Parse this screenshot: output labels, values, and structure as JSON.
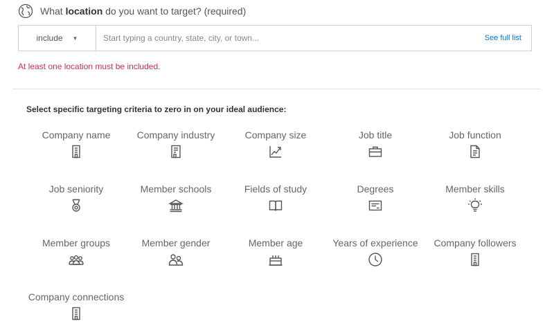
{
  "question": {
    "prefix": "What ",
    "bold": "location",
    "suffix": " do you want to target? (required)"
  },
  "location_box": {
    "include_label": "include",
    "caret": "▼",
    "placeholder": "Start typing a country, state, city, or town...",
    "see_full_list": "See full list"
  },
  "error_message": "At least one location must be included.",
  "criteria_intro": "Select specific targeting criteria to zero in on your ideal audience:",
  "criteria": [
    {
      "label": "Company name",
      "icon": "building-icon"
    },
    {
      "label": "Company industry",
      "icon": "industry-icon"
    },
    {
      "label": "Company size",
      "icon": "chart-growth-icon"
    },
    {
      "label": "Job title",
      "icon": "briefcase-icon"
    },
    {
      "label": "Job function",
      "icon": "document-icon"
    },
    {
      "label": "Job seniority",
      "icon": "medal-icon"
    },
    {
      "label": "Member schools",
      "icon": "school-icon"
    },
    {
      "label": "Fields of study",
      "icon": "book-icon"
    },
    {
      "label": "Degrees",
      "icon": "diploma-icon"
    },
    {
      "label": "Member skills",
      "icon": "lightbulb-icon"
    },
    {
      "label": "Member groups",
      "icon": "group-icon"
    },
    {
      "label": "Member gender",
      "icon": "gender-people-icon"
    },
    {
      "label": "Member age",
      "icon": "cake-icon"
    },
    {
      "label": "Years of experience",
      "icon": "clock-icon"
    },
    {
      "label": "Company followers",
      "icon": "building-icon"
    },
    {
      "label": "Company connections",
      "icon": "building-icon"
    }
  ]
}
